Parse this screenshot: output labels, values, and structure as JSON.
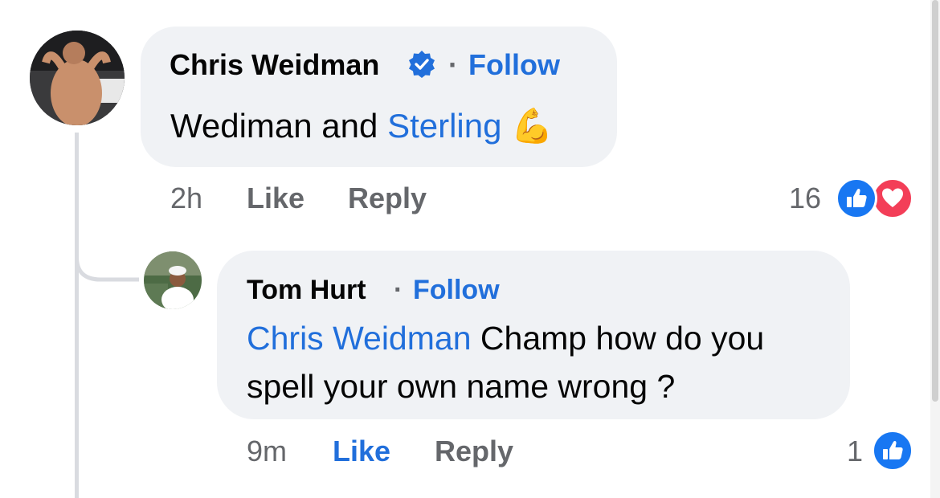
{
  "comment_main": {
    "author": "Chris Weidman",
    "follow_label": "Follow",
    "separator": "·",
    "text": "Wediman and",
    "mention": "Sterling",
    "emoji": "💪",
    "time": "2h",
    "like_label": "Like",
    "reply_label": "Reply",
    "reaction_count": "16",
    "reactions": [
      "like-icon",
      "love-icon"
    ],
    "verified": true
  },
  "reply": {
    "author": "Tom Hurt",
    "follow_label": "Follow",
    "separator": "·",
    "mention": "Chris Weidman",
    "text_line1": "Champ how do you",
    "text_line2": "spell your own name wrong ?",
    "time": "9m",
    "like_label": "Like",
    "liked": true,
    "reply_label": "Reply",
    "reaction_count": "1",
    "reactions": [
      "like-icon"
    ]
  },
  "colors": {
    "accent_blue": "#216fdb",
    "bubble_bg": "#f0f2f5",
    "meta_gray": "#65676b",
    "love_red": "#f33e58"
  }
}
